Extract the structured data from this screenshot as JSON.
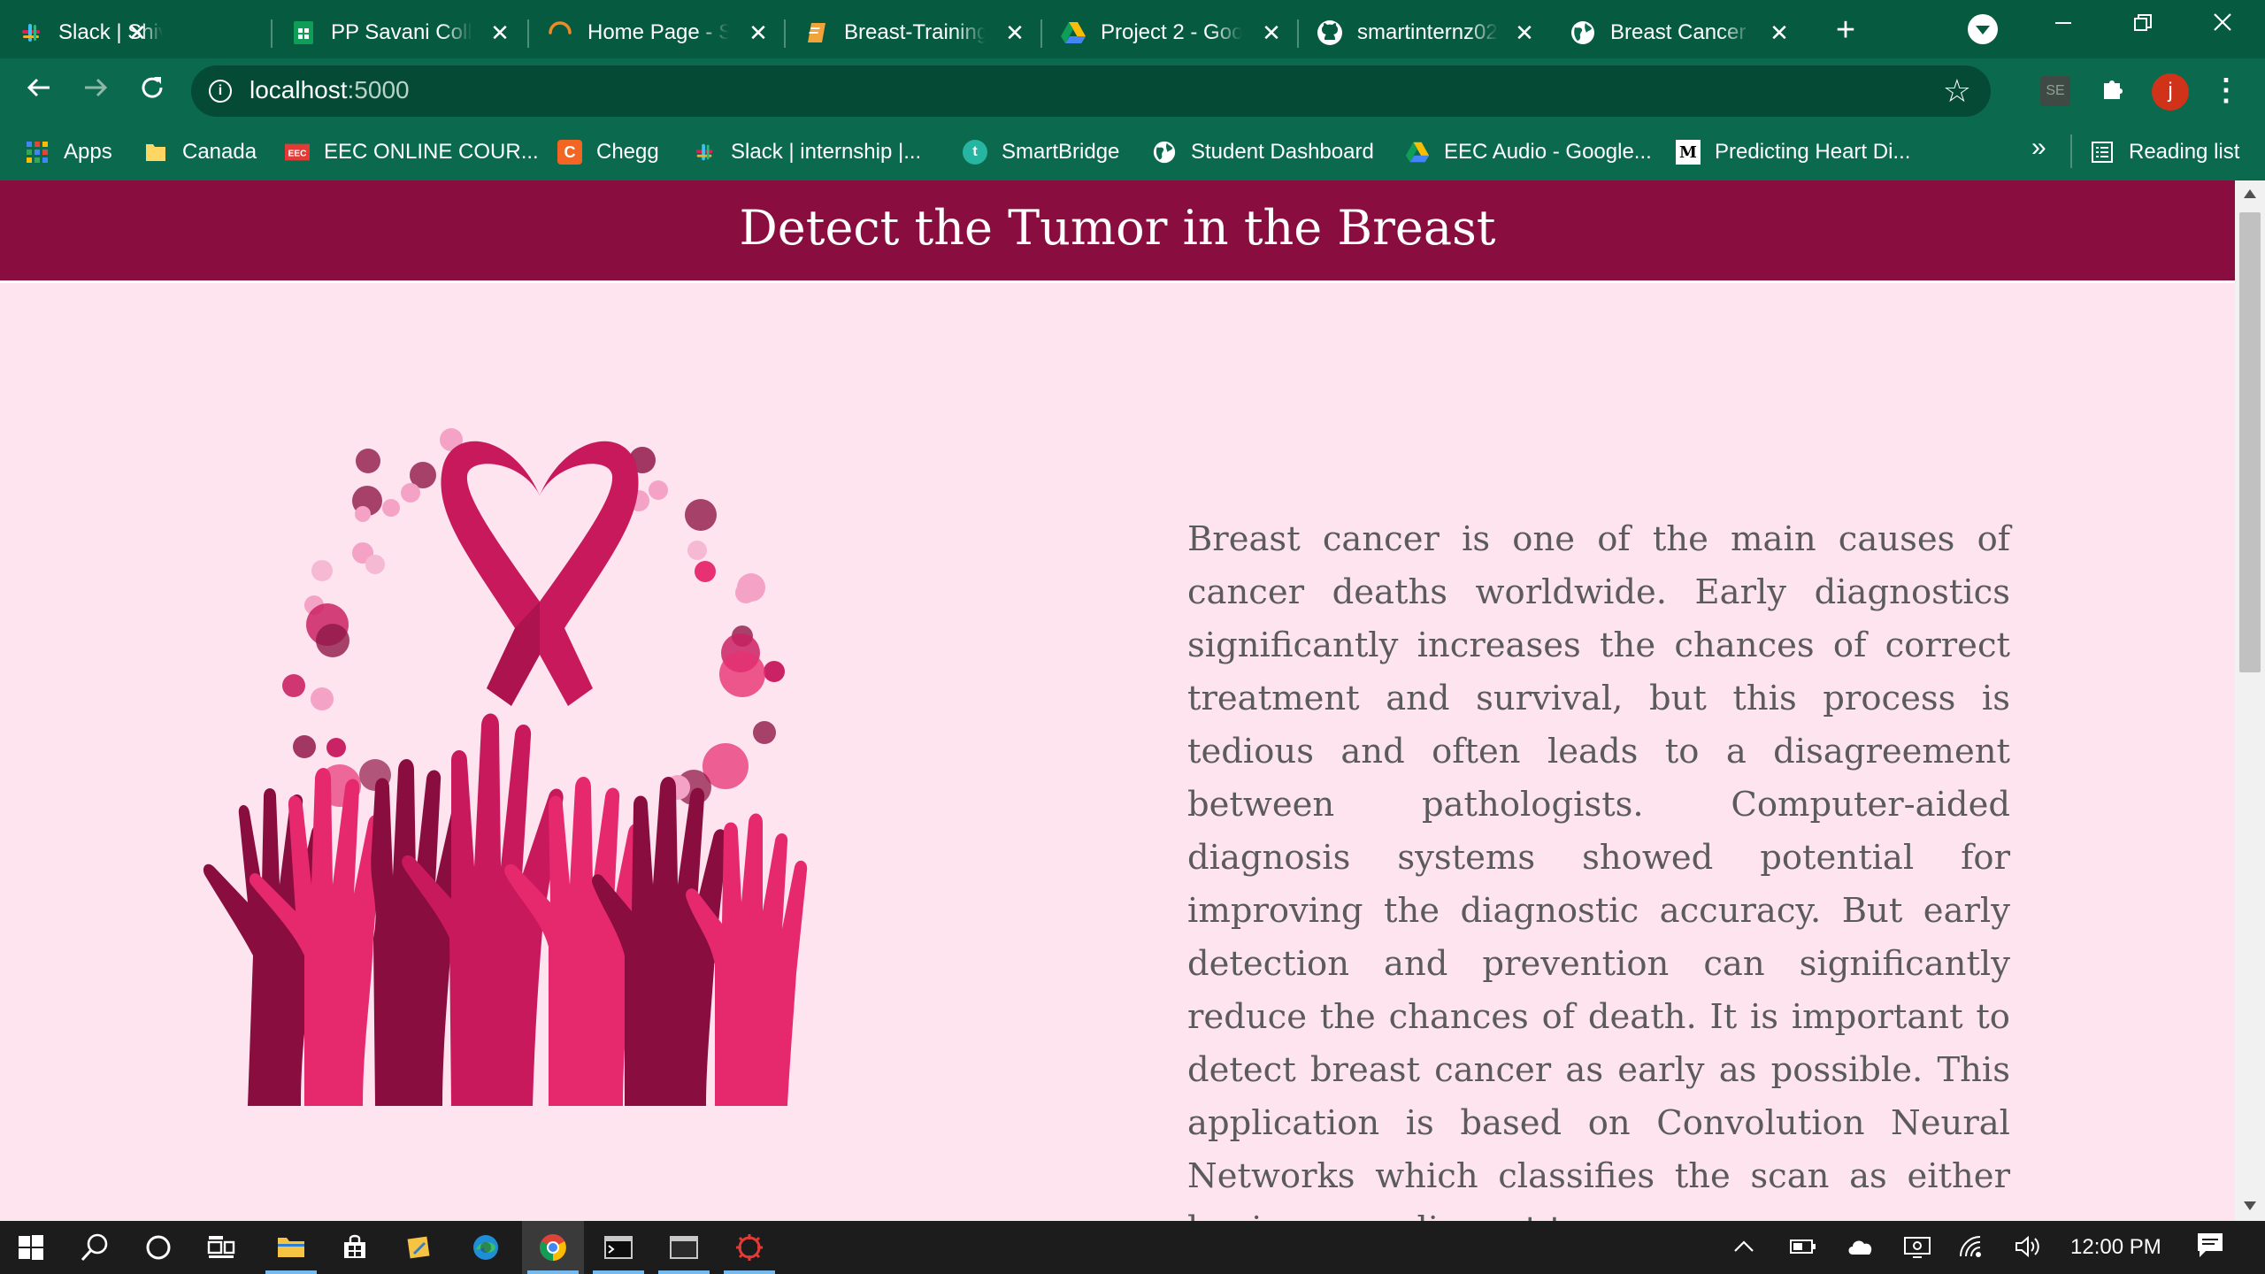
{
  "browser": {
    "tabs": [
      {
        "title": "Slack | Shivam S",
        "icon": "slack-icon"
      },
      {
        "title": "PP Savani Colle",
        "icon": "google-sheets-icon"
      },
      {
        "title": "Home Page - Sm",
        "icon": "loading-spinner-icon"
      },
      {
        "title": "Breast-Training",
        "icon": "notebook-icon"
      },
      {
        "title": "Project 2 - Goo",
        "icon": "google-drive-icon"
      },
      {
        "title": "smartinternz02",
        "icon": "github-icon"
      },
      {
        "title": "Breast Cancer D",
        "icon": "globe-icon",
        "active": true
      }
    ],
    "close_glyph": "✕",
    "new_tab_glyph": "+",
    "address": {
      "host": "localhost",
      "port": ":5000"
    },
    "profile_initial": "j",
    "extension_label": "SE",
    "bookmarks": [
      {
        "label": "Apps",
        "icon": "apps-grid-icon"
      },
      {
        "label": "Canada",
        "icon": "folder-icon"
      },
      {
        "label": "EEC ONLINE COUR...",
        "icon": "eec-icon"
      },
      {
        "label": "Chegg",
        "icon": "chegg-icon"
      },
      {
        "label": "Slack | internship |...",
        "icon": "slack-icon"
      },
      {
        "label": "SmartBridge",
        "icon": "smartbridge-icon"
      },
      {
        "label": "Student Dashboard",
        "icon": "globe-icon"
      },
      {
        "label": "EEC Audio - Google...",
        "icon": "google-drive-icon"
      },
      {
        "label": "Predicting Heart Di...",
        "icon": "medium-icon"
      }
    ],
    "bookmarks_more": "»",
    "reading_list": "Reading list"
  },
  "page": {
    "title": "Detect the Tumor in the Breast",
    "description": "Breast cancer is one of the main causes of cancer deaths worldwide. Early diagnostics significantly increases the chances of correct treatment and survival, but this process is tedious and often leads to a disagreement between pathologists. Computer-aided diagnosis systems showed potential for improving the diagnostic accuracy. But early detection and prevention can significantly reduce the chances of death. It is important to detect breast cancer as early as possible. This application is based on Convolution Neural Networks which classifies the scan as either benign or malignant tumor.",
    "colors": {
      "header": "#8a0d3f",
      "background": "#fde4ef",
      "ribbon": "#c8195d",
      "hand_dark": "#8a0d3f",
      "hand_mid": "#c8195d",
      "hand_light": "#e6286c"
    }
  },
  "taskbar": {
    "clock": "12:00 PM",
    "items": [
      "windows-start-icon",
      "search-icon",
      "cortana-icon",
      "task-view-icon",
      "file-explorer-icon",
      "store-icon",
      "sticky-notes-icon",
      "edge-icon",
      "chrome-icon",
      "terminal-icon",
      "window-icon",
      "app-icon"
    ]
  }
}
